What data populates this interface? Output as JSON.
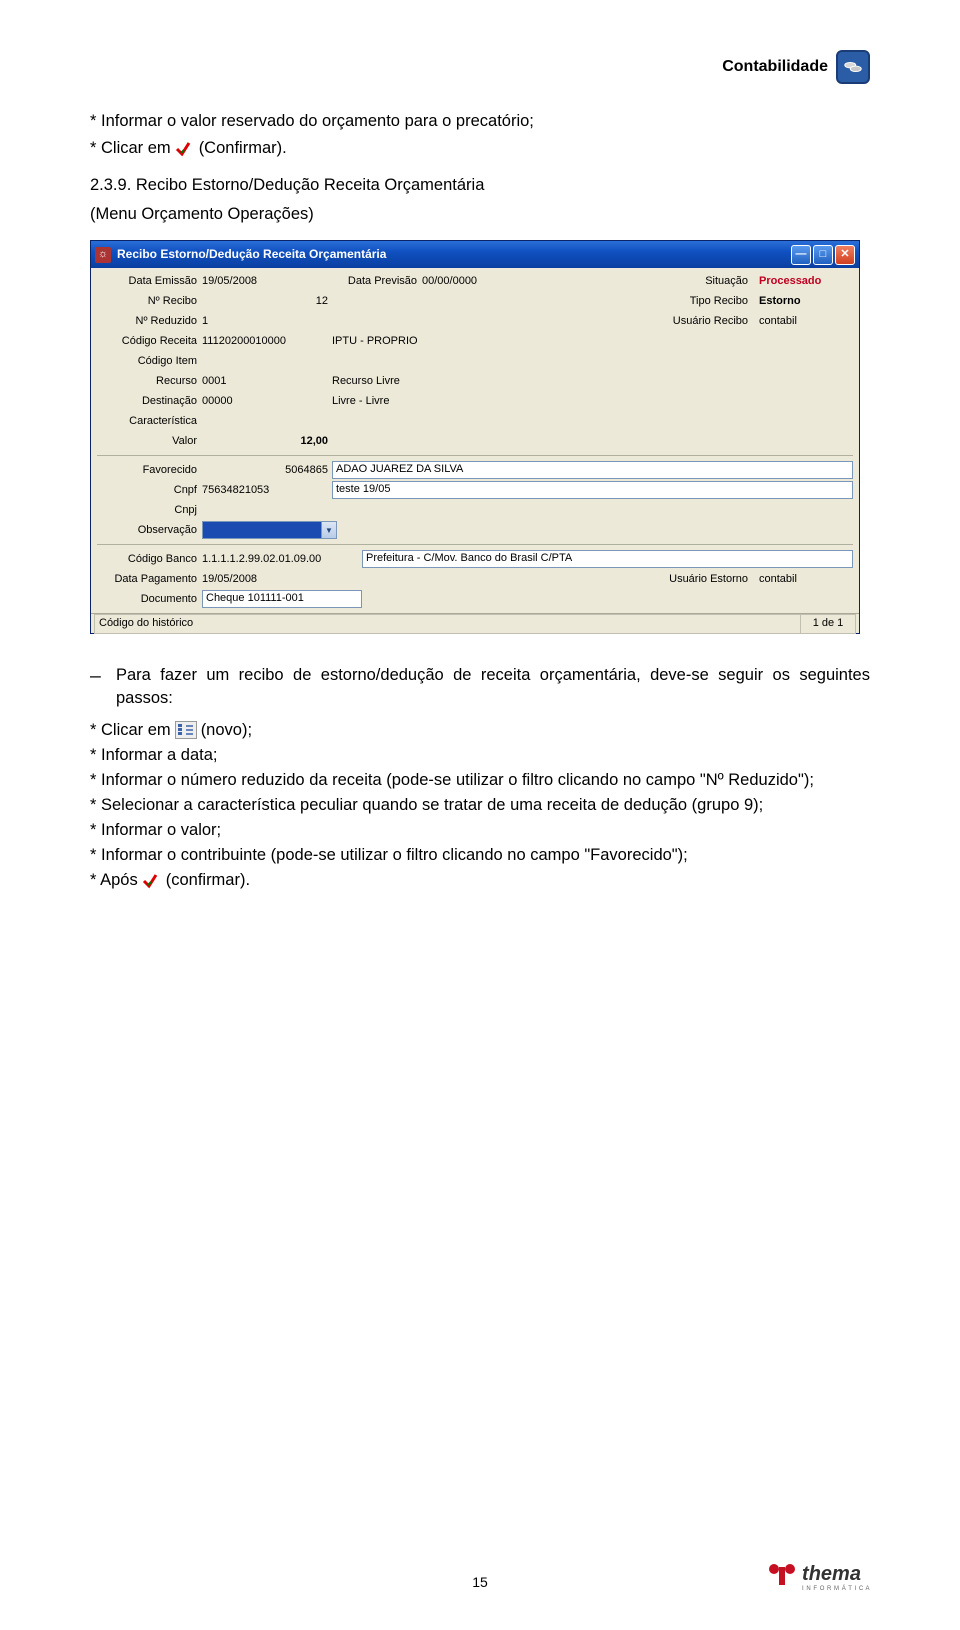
{
  "header": {
    "title": "Contabilidade",
    "icon": "coins-icon"
  },
  "intro": {
    "line1_pre": "* Informar o valor reservado do orçamento para o precatório;",
    "line2_pre": "* Clicar em",
    "line2_post": "(Confirmar)."
  },
  "section": {
    "number_title": "2.3.9. Recibo Estorno/Dedução Receita Orçamentária",
    "subtitle": "(Menu Orçamento Operações)"
  },
  "window": {
    "title": "Recibo Estorno/Dedução Receita Orçamentária",
    "fields": {
      "data_emissao_lbl": "Data Emissão",
      "data_emissao": "19/05/2008",
      "data_previsao_lbl": "Data Previsão",
      "data_previsao": "00/00/0000",
      "situacao_lbl": "Situação",
      "situacao": "Processado",
      "n_recibo_lbl": "Nº Recibo",
      "n_recibo": "12",
      "tipo_recibo_lbl": "Tipo Recibo",
      "tipo_recibo": "Estorno",
      "n_reduzido_lbl": "Nº Reduzido",
      "n_reduzido": "1",
      "usuario_recibo_lbl": "Usuário Recibo",
      "usuario_recibo": "contabil",
      "codigo_receita_lbl": "Código Receita",
      "codigo_receita": "11120200010000",
      "codigo_receita_desc": "IPTU - PROPRIO",
      "codigo_item_lbl": "Código Item",
      "recurso_lbl": "Recurso",
      "recurso": "0001",
      "recurso_desc": "Recurso Livre",
      "destinacao_lbl": "Destinação",
      "destinacao": "00000",
      "destinacao_desc": "Livre - Livre",
      "caracteristica_lbl": "Característica",
      "valor_lbl": "Valor",
      "valor": "12,00",
      "favorecido_lbl": "Favorecido",
      "favorecido_cod": "5064865",
      "favorecido_nome": "ADAO JUAREZ DA SILVA",
      "cnpf_lbl": "Cnpf",
      "cnpf": "75634821053",
      "cnpf_desc": "teste 19/05",
      "cnpj_lbl": "Cnpj",
      "observacao_lbl": "Observação",
      "codigo_banco_lbl": "Código Banco",
      "codigo_banco": "1.1.1.1.2.99.02.01.09.00",
      "codigo_banco_desc": "Prefeitura - C/Mov. Banco do Brasil C/PTA",
      "data_pagamento_lbl": "Data Pagamento",
      "data_pagamento": "19/05/2008",
      "usuario_estorno_lbl": "Usuário Estorno",
      "usuario_estorno": "contabil",
      "documento_lbl": "Documento",
      "documento": "Cheque 101111-001"
    },
    "statusbar": {
      "left": "Código do histórico",
      "right": "1 de 1"
    }
  },
  "body": {
    "bullet": "Para fazer um recibo de estorno/dedução de receita orçamentária, deve-se seguir os seguintes passos:",
    "i1_pre": "* Clicar em",
    "i1_post": "(novo);",
    "i2": "* Informar a data;",
    "i3": "* Informar o número reduzido da receita (pode-se utilizar o filtro clicando no campo \"Nº Reduzido\");",
    "i4": "* Selecionar a característica peculiar quando se tratar de uma receita de dedução (grupo 9);",
    "i5": "* Informar o valor;",
    "i6": "* Informar o contribuinte (pode-se utilizar o filtro clicando no campo \"Favorecido\");",
    "i7_pre": "* Após",
    "i7_post": "(confirmar)."
  },
  "page_number": "15",
  "footer_brand": "thema",
  "footer_sub": "I N F O R M Á T I C A"
}
